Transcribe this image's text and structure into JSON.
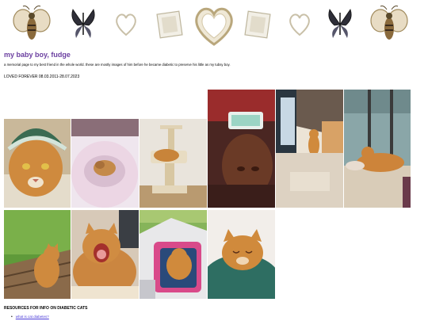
{
  "page": {
    "title": "my baby boy, fudge",
    "subtitle": "a memorial page to my best friend in the whole world. these are mostly images of him before he became diabetic to preserve his little as my tubsy boy.",
    "loved": "LOVED FOREVER 08.03.2011-28.07.2023"
  },
  "banner": {
    "items": [
      "bee-icon",
      "butterfly-icon",
      "heart-icon",
      "photo-frame-icon",
      "heart-frame-icon",
      "photo-frame-icon",
      "heart-icon",
      "butterfly-icon",
      "bee-icon"
    ]
  },
  "gallery": {
    "photos": [
      "cat-with-knit-hat-photo",
      "cat-in-pink-bed-photo",
      "cat-on-scratching-tower-photo",
      "cat-in-red-light-photo",
      "cat-on-floor-with-bags-photo",
      "cat-by-window-photo",
      "cat-on-bench-grass-photo",
      "cat-yawning-photo",
      "cat-in-carrier-photo",
      "cat-sleeping-green-blanket-photo"
    ]
  },
  "resources": {
    "heading": "RESOURCES FOR INFO ON DIABETIC CATS",
    "links": [
      "what is cat diabetes?"
    ]
  },
  "colors": {
    "title": "#6b3fa0",
    "link": "#4a3ad8",
    "cat": "#d08a3c"
  }
}
